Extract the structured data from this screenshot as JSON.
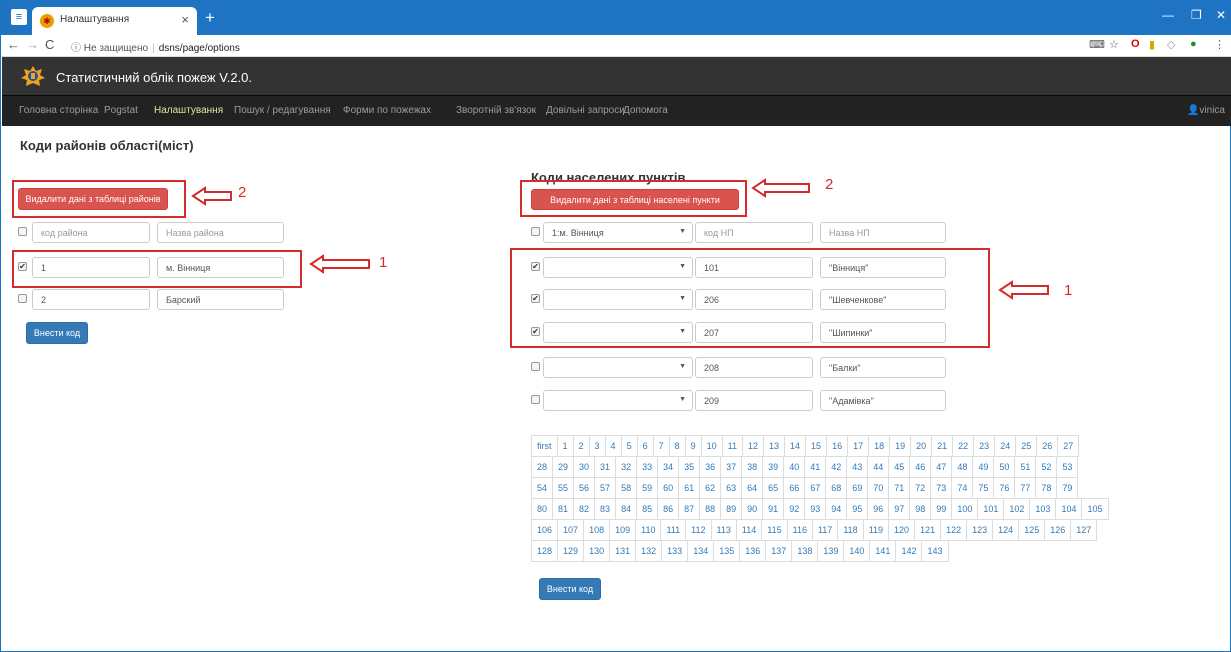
{
  "browser": {
    "tab_title": "Налаштування",
    "security": "Не защищено",
    "url": "dsns/page/options"
  },
  "app": {
    "title": "Статистичний облік пожеж V.2.0.",
    "nav": [
      "Головна сторінка",
      "Pogstat",
      "Налаштування",
      "Пошук / редагування",
      "Форми по пожежах",
      "Зворотній зв'язок",
      "Довільні запроси",
      "Допомога"
    ],
    "user": "vinica"
  },
  "left": {
    "heading": "Коди районів області(міст)",
    "delete_button": "Видалити дані з таблиці районів",
    "code_placeholder": "код района",
    "name_placeholder": "Назва района",
    "rows": [
      {
        "checked": true,
        "code": "1",
        "name": "м. Вінниця"
      },
      {
        "checked": false,
        "code": "2",
        "name": "Барский"
      }
    ],
    "submit_button": "Внести код"
  },
  "right": {
    "heading": "Коди населених пунктів",
    "delete_button": "Видалити дані з таблиці населені пункти",
    "filter_select": "1:м. Вінниця",
    "code_placeholder": "код НП",
    "name_placeholder": "Назва НП",
    "rows": [
      {
        "checked": true,
        "code": "101",
        "name": "\"Вінниця\""
      },
      {
        "checked": true,
        "code": "206",
        "name": "\"Шевченкове\""
      },
      {
        "checked": true,
        "code": "207",
        "name": "\"Шипинки\""
      },
      {
        "checked": false,
        "code": "208",
        "name": "\"Балки\""
      },
      {
        "checked": false,
        "code": "209",
        "name": "\"Адамівка\""
      }
    ],
    "pagination_first": "first",
    "pages_count": 143,
    "submit_button": "Внести код"
  },
  "annotations": {
    "label_1": "1",
    "label_2": "2"
  },
  "colors": {
    "danger": "#d9534f",
    "primary": "#337ab7",
    "annotation": "#d62b2b"
  }
}
